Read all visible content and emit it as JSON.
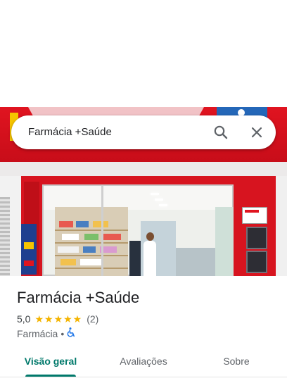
{
  "search": {
    "query": "Farmácia +Saúde",
    "search_icon": "search-icon",
    "close_icon": "close-icon"
  },
  "place": {
    "name": "Farmácia +Saúde",
    "rating": "5,0",
    "stars": "★★★★★",
    "review_count": "(2)",
    "category": "Farmácia",
    "separator": "•",
    "accessibility_icon": "wheelchair-icon"
  },
  "tabs": [
    {
      "label": "Visão geral",
      "active": true
    },
    {
      "label": "Avaliações",
      "active": false
    },
    {
      "label": "Sobre",
      "active": false
    }
  ],
  "colors": {
    "accent": "#00796b",
    "star": "#f4b400",
    "storefront_red": "#d7141f",
    "accessibility_blue": "#1a73e8"
  }
}
